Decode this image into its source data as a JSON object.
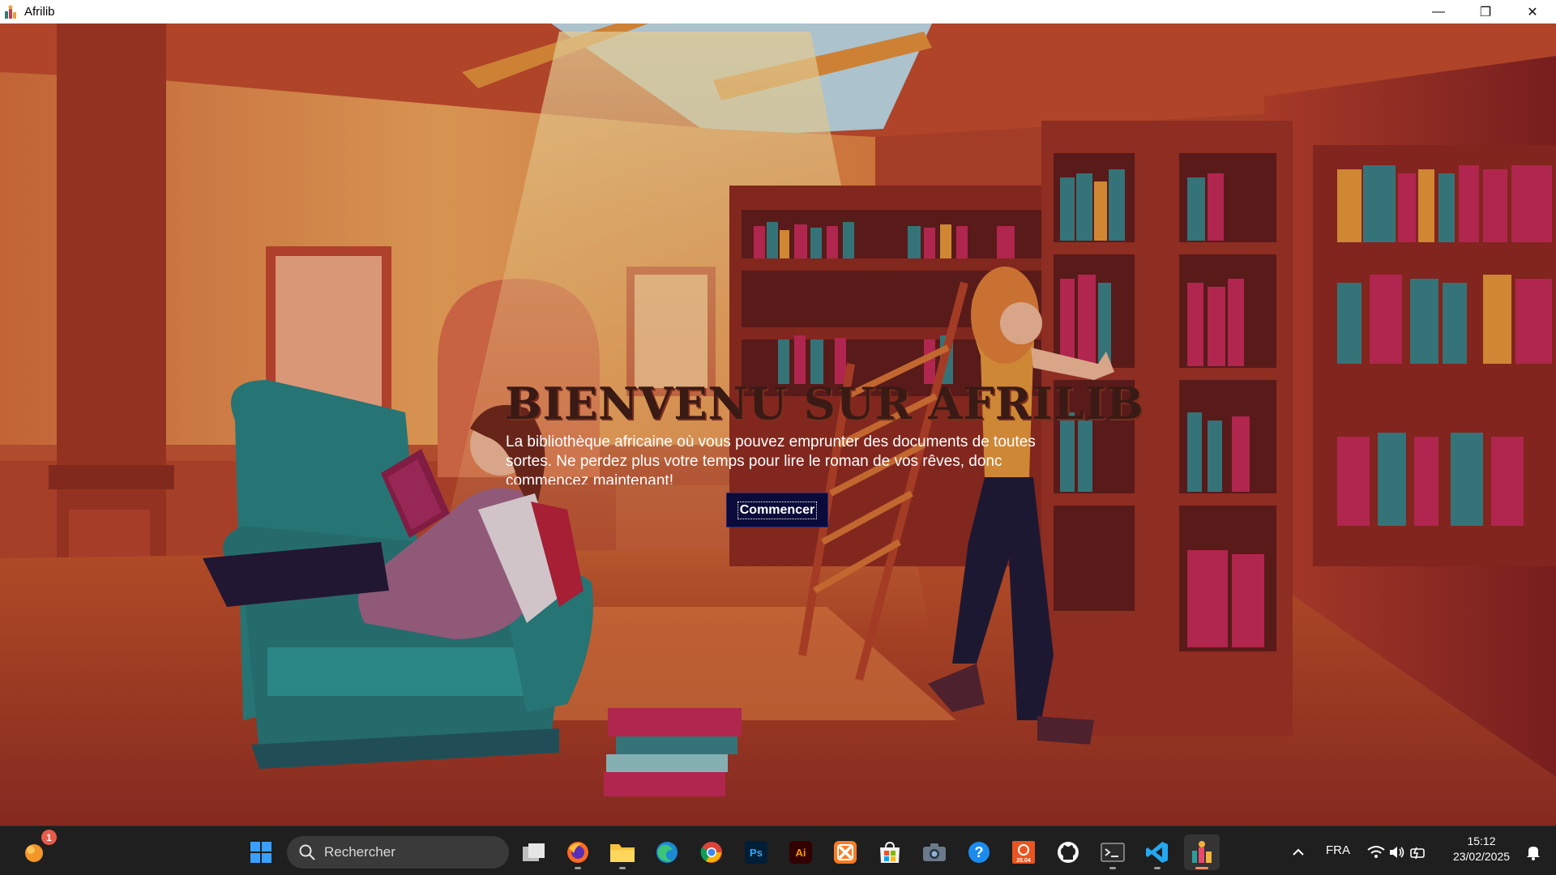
{
  "window": {
    "title": "Afrilib",
    "minimize_glyph": "—",
    "restore_glyph": "❐",
    "close_glyph": "✕"
  },
  "hero": {
    "title": "BIENVENU SUR AFRILIB",
    "description": "La bibliothèque africaine où vous pouvez emprunter des documents de toutes sortes. Ne perdez plus votre temps pour lire le roman de vos rêves, donc commencez maintenant!",
    "button_label": "Commencer"
  },
  "taskbar": {
    "search_placeholder": "Rechercher",
    "notification_count": "1",
    "pinned_apps": [
      {
        "name": "Task View",
        "icon": "task-view-icon"
      },
      {
        "name": "Firefox",
        "icon": "firefox-icon"
      },
      {
        "name": "File Explorer",
        "icon": "file-explorer-icon"
      },
      {
        "name": "Edge",
        "icon": "edge-icon"
      },
      {
        "name": "Chrome",
        "icon": "chrome-icon"
      },
      {
        "name": "Photoshop",
        "icon": "photoshop-icon",
        "text": "Ps"
      },
      {
        "name": "Illustrator",
        "icon": "illustrator-icon",
        "text": "Ai"
      },
      {
        "name": "XAMPP",
        "icon": "xampp-icon"
      },
      {
        "name": "Microsoft Store",
        "icon": "store-icon"
      },
      {
        "name": "Camera",
        "icon": "camera-icon"
      },
      {
        "name": "Get Help",
        "icon": "help-icon"
      },
      {
        "name": "Ubuntu 20.04",
        "icon": "ubuntu-icon",
        "text": "20.04"
      },
      {
        "name": "GitHub Desktop",
        "icon": "github-icon"
      },
      {
        "name": "Terminal",
        "icon": "terminal-icon"
      },
      {
        "name": "VS Code",
        "icon": "vscode-icon"
      },
      {
        "name": "Afrilib",
        "icon": "afrilib-icon"
      }
    ],
    "tray": {
      "language": "FRA",
      "time": "15:12",
      "date": "23/02/2025"
    }
  },
  "colors": {
    "button_bg": "#0b0b3b",
    "title_color": "#3a1a14",
    "taskbar_bg": "#1f1f1f"
  }
}
